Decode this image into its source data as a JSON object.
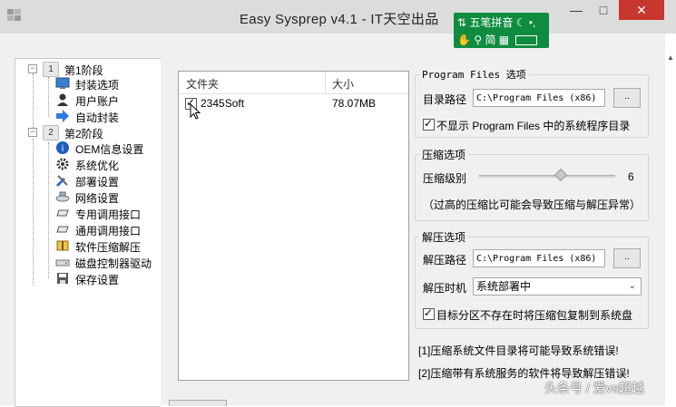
{
  "window": {
    "title": "Easy Sysprep v4.1 - IT天空出品"
  },
  "ime": {
    "row1": "五笔拼音",
    "row2": "简"
  },
  "tree": {
    "stage1": {
      "num": "1",
      "label": "第1阶段"
    },
    "stage1_items": [
      "封装选项",
      "用户账户",
      "自动封装"
    ],
    "stage2": {
      "num": "2",
      "label": "第2阶段"
    },
    "stage2_items": [
      "OEM信息设置",
      "系统优化",
      "部署设置",
      "网络设置",
      "专用调用接口",
      "通用调用接口",
      "软件压缩解压",
      "磁盘控制器驱动",
      "保存设置"
    ]
  },
  "list": {
    "col_folder": "文件夹",
    "col_size": "大小",
    "rows": [
      {
        "name": "2345Soft",
        "size": "78.07MB",
        "checked": true
      }
    ]
  },
  "pf": {
    "title": "Program Files 选项",
    "dir_label": "目录路径",
    "dir_value": "C:\\Program Files (x86)",
    "browse": "..",
    "hide_label": "不显示 Program Files 中的系统程序目录",
    "hide_checked": true
  },
  "compress": {
    "title": "压缩选项",
    "level_label": "压缩级别",
    "level_value": "6",
    "level_fraction": 0.6,
    "note": "（过高的压缩比可能会导致压缩与解压异常）"
  },
  "decompress": {
    "title": "解压选项",
    "path_label": "解压路径",
    "path_value": "C:\\Program Files (x86)",
    "browse": "..",
    "time_label": "解压时机",
    "time_value": "系统部署中",
    "copy_label": "目标分区不存在时将压缩包复制到系统盘",
    "copy_checked": true
  },
  "warnings": [
    "[1]压缩系统文件目录将可能导致系统错误!",
    "[2]压缩带有系统服务的软件将导致解压错误!"
  ],
  "watermark": "头条号 / 爱vs超越",
  "colors": {
    "ime_bg": "#0f8c3f",
    "close_bg": "#c7372f",
    "title_bg": "#dcdcdc"
  }
}
